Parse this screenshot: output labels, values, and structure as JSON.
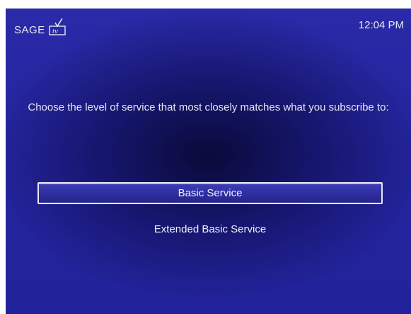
{
  "header": {
    "logo_text": "SAGE",
    "logo_icon": "tv-checkmark-icon",
    "clock": "12:04 PM"
  },
  "main": {
    "prompt": "Choose the level of service that most closely matches what you subscribe to:",
    "options": [
      {
        "label": "Basic Service",
        "selected": true
      },
      {
        "label": "Extended Basic Service",
        "selected": false
      }
    ]
  },
  "colors": {
    "background": "#2626a2",
    "highlight_border": "#e8e8f0",
    "text": "#ffffff"
  }
}
